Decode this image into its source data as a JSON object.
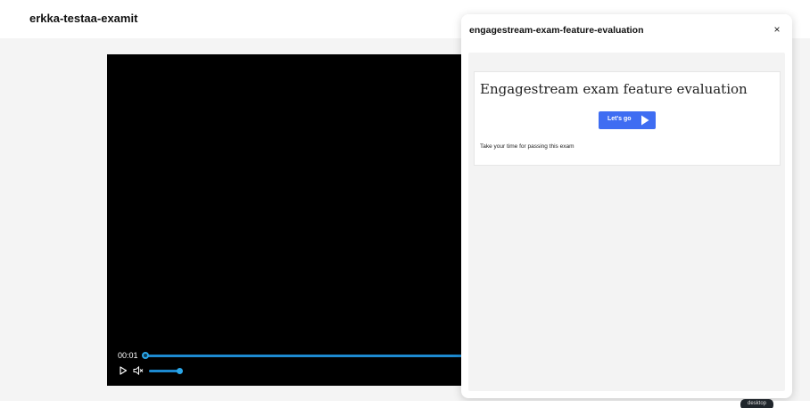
{
  "header": {
    "title": "erkka-testaa-examit"
  },
  "video": {
    "current_time": "00:01",
    "progress_fraction": 0.0,
    "volume_fraction": 1.0,
    "progress_color": "#1d8ad0"
  },
  "panel": {
    "title": "engagestream-exam-feature-evaluation",
    "close_label": "×",
    "card": {
      "heading": "Engagestream exam feature evaluation",
      "button_label": "Let's go",
      "note": "Take your time for passing this exam"
    },
    "accent_color": "#3f6df2"
  },
  "env_badge": "desktop"
}
